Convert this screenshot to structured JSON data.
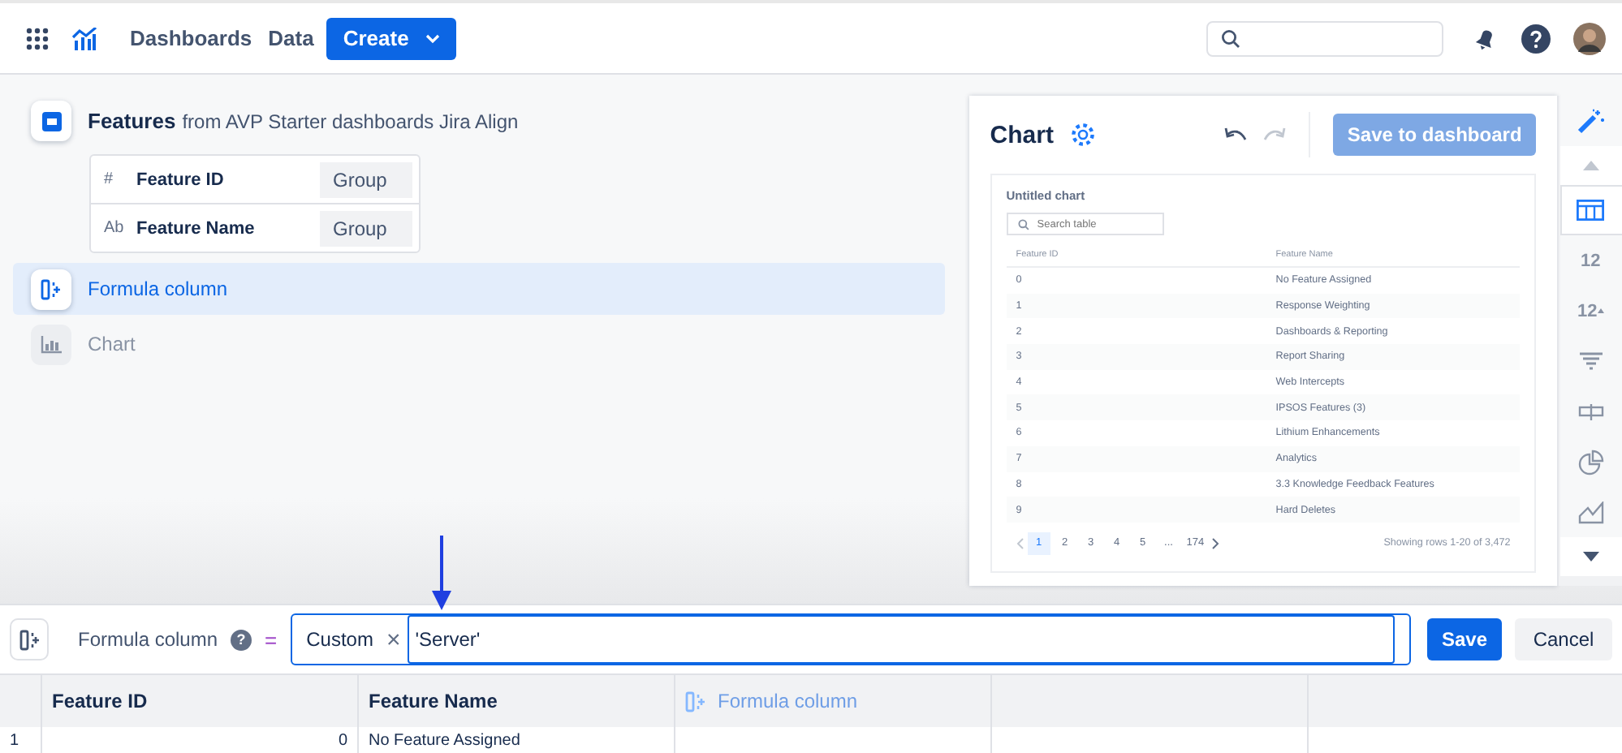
{
  "nav": {
    "items": [
      "Dashboards",
      "Data"
    ],
    "create_button": "Create"
  },
  "pipeline": {
    "source": {
      "title": "Features",
      "subtitle": "from AVP Starter dashboards Jira Align",
      "fields": [
        {
          "type_label": "#",
          "name": "Feature ID",
          "action": "Group"
        },
        {
          "type_label": "Ab",
          "name": "Feature Name",
          "action": "Group"
        }
      ]
    },
    "steps": [
      {
        "kind": "formula",
        "label": "Formula column",
        "selected": true,
        "disabled": false
      },
      {
        "kind": "chart",
        "label": "Chart",
        "selected": false,
        "disabled": true
      }
    ]
  },
  "chart_panel": {
    "title": "Chart",
    "save_button": "Save to dashboard",
    "preview": {
      "title": "Untitled chart",
      "search_placeholder": "Search table",
      "columns": [
        "Feature ID",
        "Feature Name"
      ],
      "rows": [
        [
          "0",
          "No Feature Assigned"
        ],
        [
          "1",
          "Response Weighting"
        ],
        [
          "2",
          "Dashboards & Reporting"
        ],
        [
          "3",
          "Report Sharing"
        ],
        [
          "4",
          "Web Intercepts"
        ],
        [
          "5",
          "IPSOS Features (3)"
        ],
        [
          "6",
          "Lithium Enhancements"
        ],
        [
          "7",
          "Analytics"
        ],
        [
          "8",
          "3.3 Knowledge Feedback Features"
        ],
        [
          "9",
          "Hard Deletes"
        ]
      ],
      "pages": [
        {
          "label": "1",
          "selected": true
        },
        {
          "label": "2",
          "selected": false
        },
        {
          "label": "3",
          "selected": false
        },
        {
          "label": "4",
          "selected": false
        },
        {
          "label": "5",
          "selected": false
        },
        {
          "label": "...",
          "selected": false
        },
        {
          "label": "174",
          "selected": false
        }
      ],
      "summary": "Showing rows 1-20 of 3,472"
    }
  },
  "rail": [
    {
      "kind": "wand",
      "selected": false
    },
    {
      "kind": "up",
      "selected": false
    },
    {
      "kind": "table",
      "selected": true
    },
    {
      "kind": "number",
      "label": "12",
      "selected": false
    },
    {
      "kind": "number-up",
      "label": "12",
      "selected": false
    },
    {
      "kind": "filter",
      "selected": false
    },
    {
      "kind": "pill",
      "selected": false
    },
    {
      "kind": "pie",
      "selected": false
    },
    {
      "kind": "area",
      "selected": false
    },
    {
      "kind": "down",
      "selected": false
    }
  ],
  "formula_bar": {
    "label": "Formula column",
    "help": "?",
    "equals": "=",
    "mode": "Custom",
    "clear": "×",
    "value": "'Server'",
    "save_button": "Save",
    "cancel_button": "Cancel"
  },
  "grid": {
    "columns": [
      {
        "kind": "plain",
        "label": "Feature ID"
      },
      {
        "kind": "plain",
        "label": "Feature Name"
      },
      {
        "kind": "formula",
        "label": "Formula column"
      }
    ],
    "rows": [
      {
        "index": "1",
        "cells": [
          "0",
          "No Feature Assigned"
        ]
      }
    ]
  }
}
